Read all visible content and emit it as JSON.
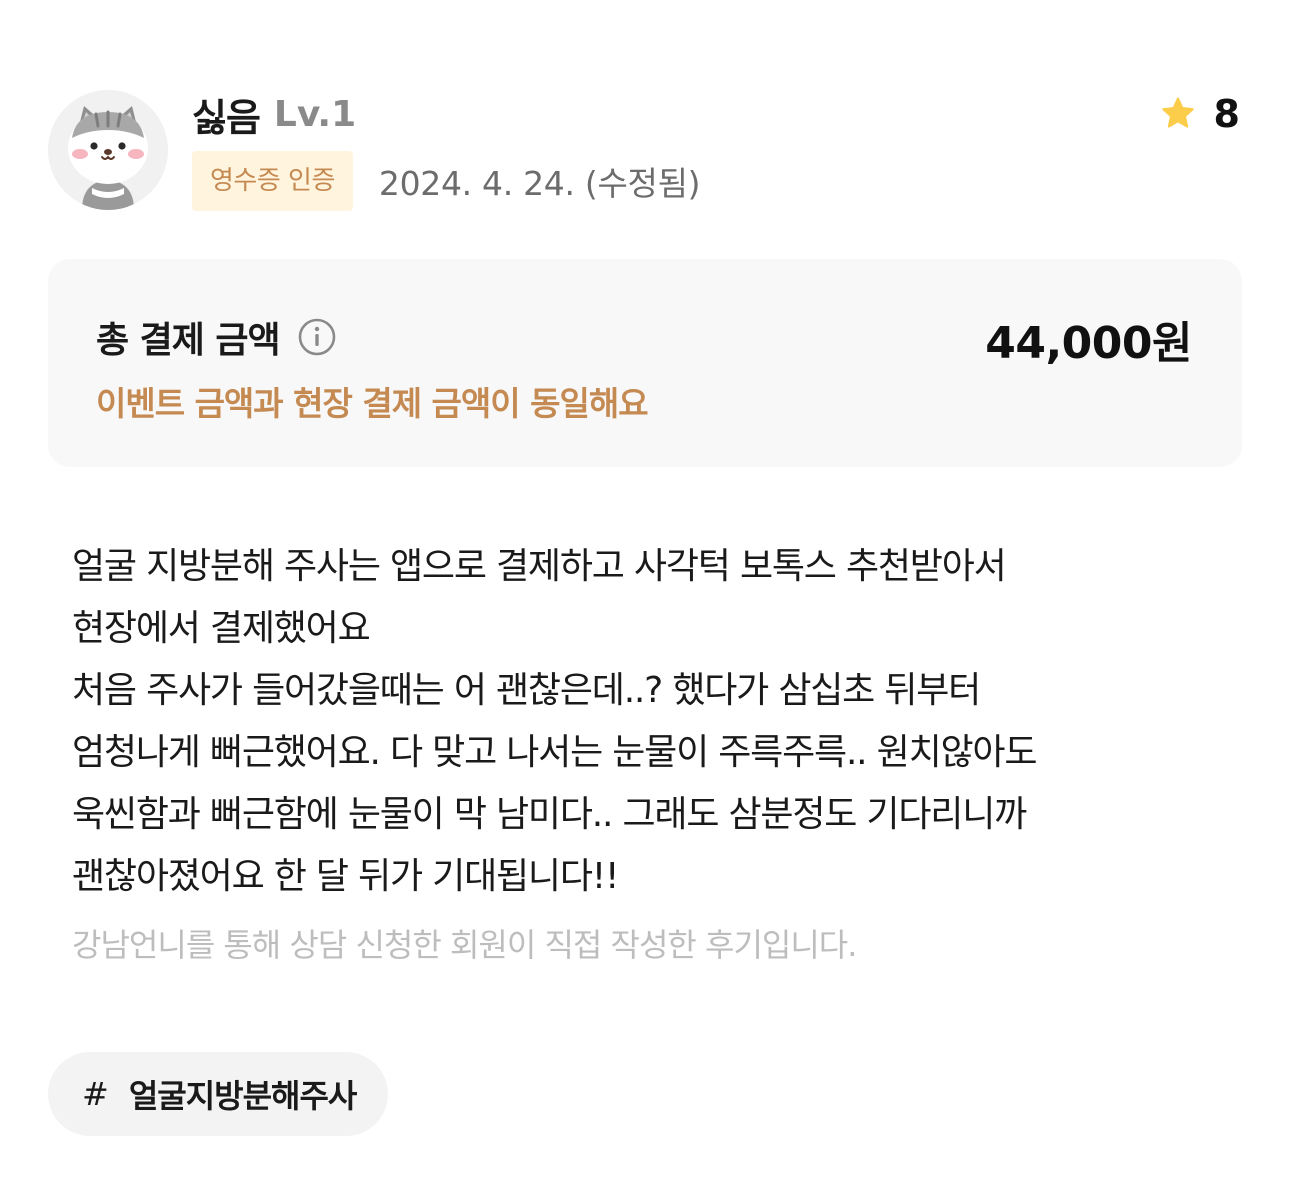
{
  "author": {
    "name": "싫음",
    "level": "Lv.1",
    "avatar": "cat-avatar"
  },
  "badge": {
    "label": "영수증 인증"
  },
  "post": {
    "date": "2024. 4. 24. (수정됨)"
  },
  "rating": {
    "icon": "star-icon",
    "value": "8",
    "star_color": "#fccd4b"
  },
  "payment": {
    "label": "총 결제 금액",
    "info_icon": "info-icon",
    "amount": "44,000원",
    "note": "이벤트 금액과 현장 결제 금액이 동일해요"
  },
  "review": {
    "lines": [
      "얼굴 지방분해 주사는 앱으로 결제하고 사각턱 보톡스 추천받아서",
      "현장에서 결제했어요",
      "처음 주사가 들어갔을때는 어 괜찮은데..? 했다가 삼십초 뒤부터",
      "엄청나게 뻐근했어요. 다 맞고 나서는 눈물이 주륵주륵.. 원치않아도",
      "욱씬함과 뻐근함에 눈물이 막 남미다.. 그래도 삼분정도 기다리니까",
      "괜찮아졌어요 한 달 뒤가 기대됩니다!!"
    ],
    "disclaimer": "강남언니를 통해 상담 신청한 회원이 직접 작성한 후기입니다."
  },
  "hashtag": {
    "symbol": "#",
    "label": "얼굴지방분해주사"
  },
  "colors": {
    "accent": "#c48a52",
    "badge_bg": "#fff4dd",
    "box_bg": "#f8f8f8",
    "chip_bg": "#f3f3f3",
    "muted_text": "#bdbdbd"
  }
}
